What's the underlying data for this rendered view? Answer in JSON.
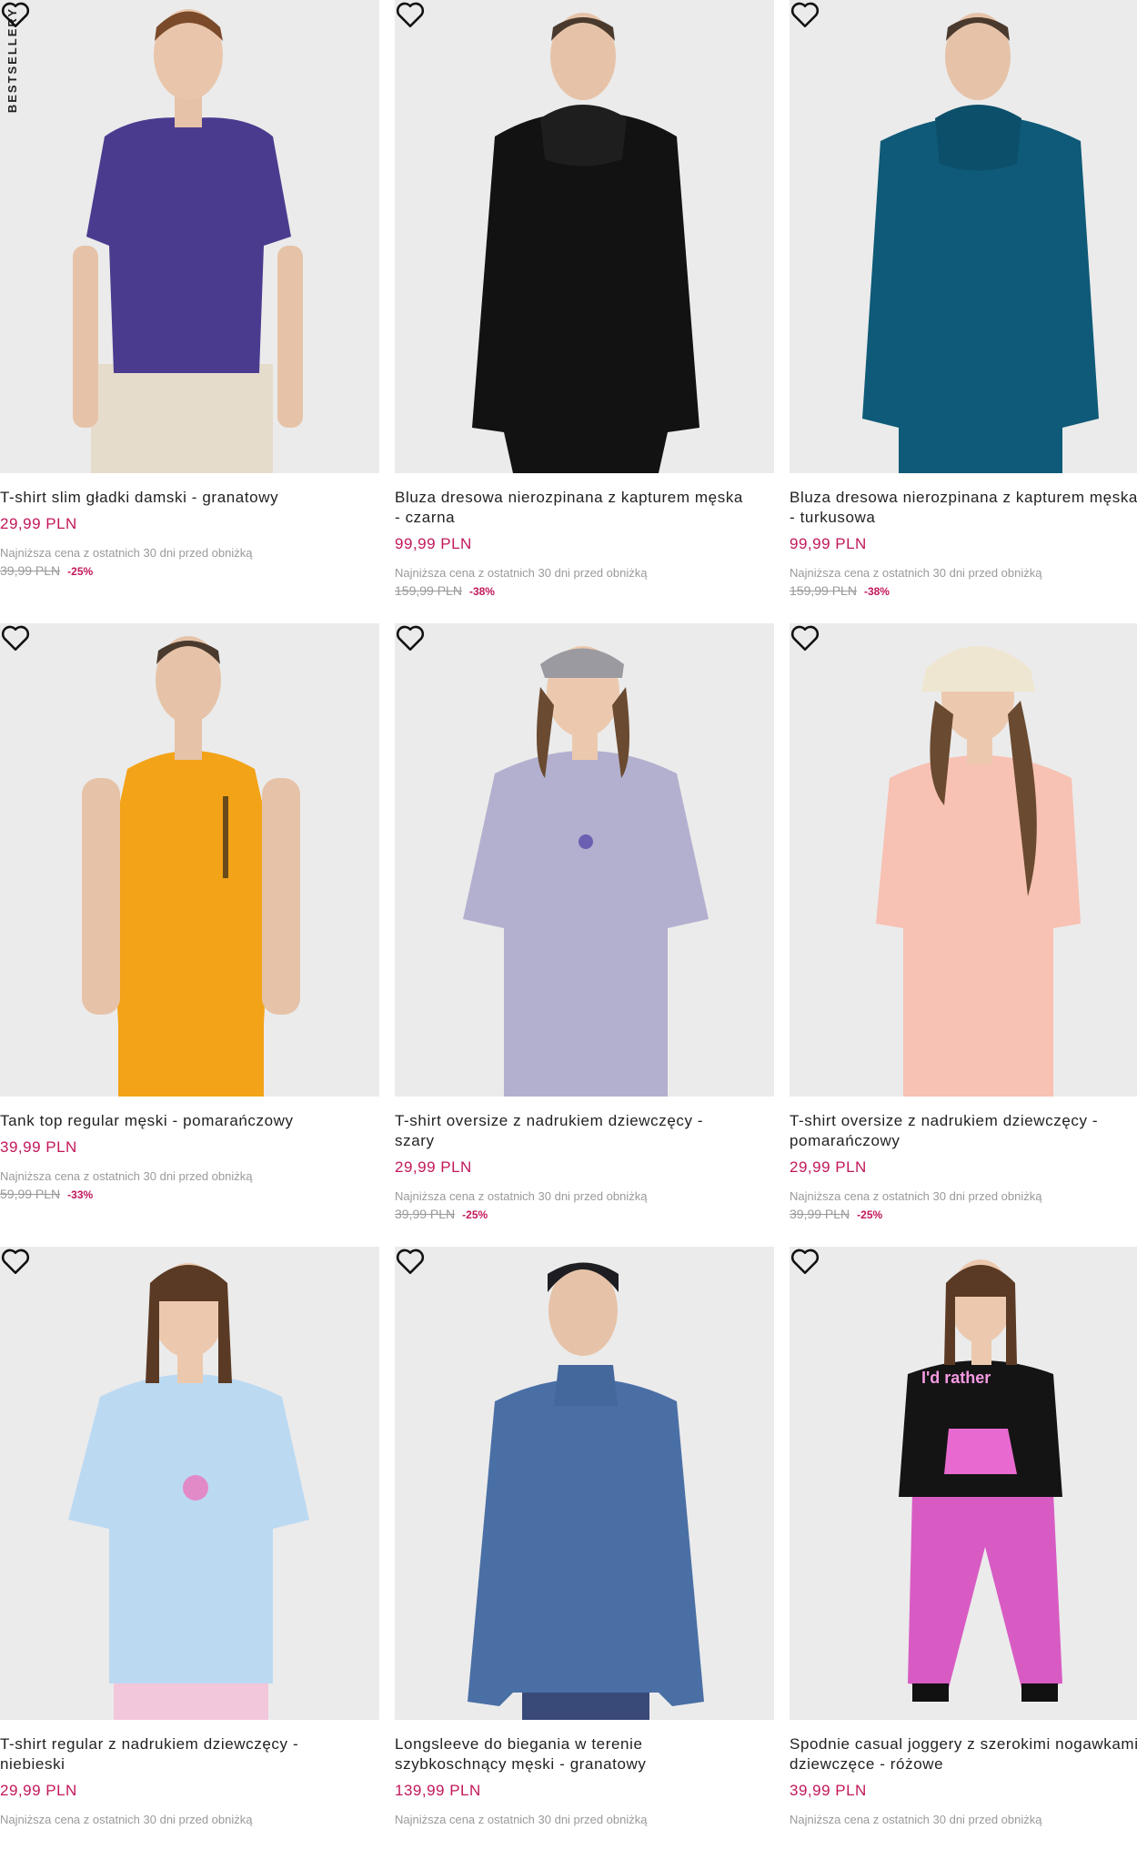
{
  "badge": "BESTSELLERY",
  "colors": {
    "price": "#c2185b",
    "muted": "#9a9a9a",
    "photo_bg": "#ebebeb"
  },
  "products": [
    {
      "name": "T-shirt slim gładki damski - granatowy",
      "price": "29,99 PLN",
      "lowest_label": "Najniższa cena z ostatnich 30 dni przed obniżką",
      "old_price": "39,99 PLN",
      "discount": "-25%",
      "garment_color": "#4b3b8f",
      "favorite_icon": "heart-icon"
    },
    {
      "name": "Bluza dresowa nierozpinana z kapturem męska\n- czarna",
      "price": "99,99 PLN",
      "lowest_label": "Najniższa cena z ostatnich 30 dni przed obniżką",
      "old_price": "159,99 PLN",
      "discount": "-38%",
      "garment_color": "#121212",
      "favorite_icon": "heart-icon"
    },
    {
      "name": "Bluza dresowa nierozpinana z kapturem męska\n- turkusowa",
      "price": "99,99 PLN",
      "lowest_label": "Najniższa cena z ostatnich 30 dni przed obniżką",
      "old_price": "159,99 PLN",
      "discount": "-38%",
      "garment_color": "#0e5a78",
      "favorite_icon": "heart-icon"
    },
    {
      "name": "Tank top regular męski - pomarańczowy",
      "price": "39,99 PLN",
      "lowest_label": "Najniższa cena z ostatnich 30 dni przed obniżką",
      "old_price": "59,99 PLN",
      "discount": "-33%",
      "garment_color": "#f3a318",
      "favorite_icon": "heart-icon"
    },
    {
      "name": "T-shirt oversize z nadrukiem dziewczęcy -\nszary",
      "price": "29,99 PLN",
      "lowest_label": "Najniższa cena z ostatnich 30 dni przed obniżką",
      "old_price": "39,99 PLN",
      "discount": "-25%",
      "garment_color": "#b3b0cf",
      "favorite_icon": "heart-icon"
    },
    {
      "name": "T-shirt oversize z nadrukiem dziewczęcy -\npomarańczowy",
      "price": "29,99 PLN",
      "lowest_label": "Najniższa cena z ostatnich 30 dni przed obniżką",
      "old_price": "39,99 PLN",
      "discount": "-25%",
      "garment_color": "#f7c1b3",
      "favorite_icon": "heart-icon"
    },
    {
      "name": "T-shirt regular z nadrukiem dziewczęcy -\nniebieski",
      "price": "29,99 PLN",
      "lowest_label": "Najniższa cena z ostatnich 30 dni przed obniżką",
      "old_price": "",
      "discount": "",
      "garment_color": "#bcd9f2",
      "favorite_icon": "heart-icon"
    },
    {
      "name": "Longsleeve do biegania w terenie\nszybkoschnący męski - granatowy",
      "price": "139,99 PLN",
      "lowest_label": "Najniższa cena z ostatnich 30 dni przed obniżką",
      "old_price": "",
      "discount": "",
      "garment_color": "#4a6fa5",
      "favorite_icon": "heart-icon"
    },
    {
      "name": "Spodnie casual joggery z szerokimi nogawkami\ndziewczęce - różowe",
      "price": "39,99 PLN",
      "lowest_label": "Najniższa cena z ostatnich 30 dni przed obniżką",
      "old_price": "",
      "discount": "",
      "garment_color": "#d85bc4",
      "favorite_icon": "heart-icon"
    }
  ],
  "print_text": "I'd rather"
}
